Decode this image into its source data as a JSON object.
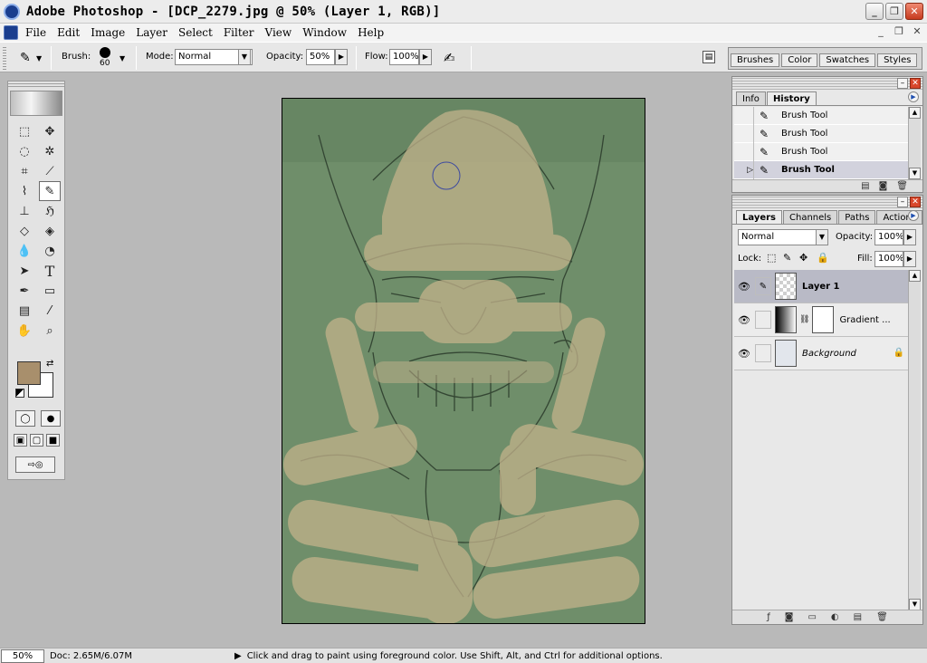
{
  "window": {
    "title": "Adobe Photoshop - [DCP_2279.jpg @ 50% (Layer 1, RGB)]",
    "minimize": "_",
    "restore": "❐",
    "close": "✕"
  },
  "menu": {
    "items": [
      "File",
      "Edit",
      "Image",
      "Layer",
      "Select",
      "Filter",
      "View",
      "Window",
      "Help"
    ],
    "mdi_minimize": "_",
    "mdi_restore": "❐",
    "mdi_close": "✕"
  },
  "options": {
    "brush_label": "Brush:",
    "brush_size": "60",
    "mode_label": "Mode:",
    "mode_value": "Normal",
    "opacity_label": "Opacity:",
    "opacity_value": "50%",
    "flow_label": "Flow:",
    "flow_value": "100%"
  },
  "palette_well": {
    "tabs": [
      "Brushes",
      "Color",
      "Swatches",
      "Styles"
    ]
  },
  "toolbox": {
    "foreground_color": "#a88f6c",
    "background_color": "#ffffff"
  },
  "history_panel": {
    "tabs": [
      "Info",
      "History"
    ],
    "active_tab": "History",
    "items": [
      {
        "label": "Brush Tool"
      },
      {
        "label": "Brush Tool"
      },
      {
        "label": "Brush Tool"
      },
      {
        "label": "Brush Tool"
      }
    ],
    "current_index": 3
  },
  "layers_panel": {
    "tabs": [
      "Layers",
      "Channels",
      "Paths",
      "Actions"
    ],
    "active_tab": "Layers",
    "blend_mode": "Normal",
    "opacity_label": "Opacity:",
    "opacity_value": "100%",
    "lock_label": "Lock:",
    "fill_label": "Fill:",
    "fill_value": "100%",
    "layers": [
      {
        "name": "Layer 1",
        "selected": true
      },
      {
        "name": "Gradient ...",
        "selected": false
      },
      {
        "name": "Background",
        "selected": false
      }
    ]
  },
  "status": {
    "zoom": "50%",
    "doc": "Doc: 2.65M/6.07M",
    "hint": "Click and drag to paint using foreground color.  Use Shift, Alt, and Ctrl for additional options."
  },
  "colors": {
    "canvas_green": "#6f8e6a",
    "paint_tan": "#c2b28b",
    "selection_highlight": "#b9bac6"
  }
}
